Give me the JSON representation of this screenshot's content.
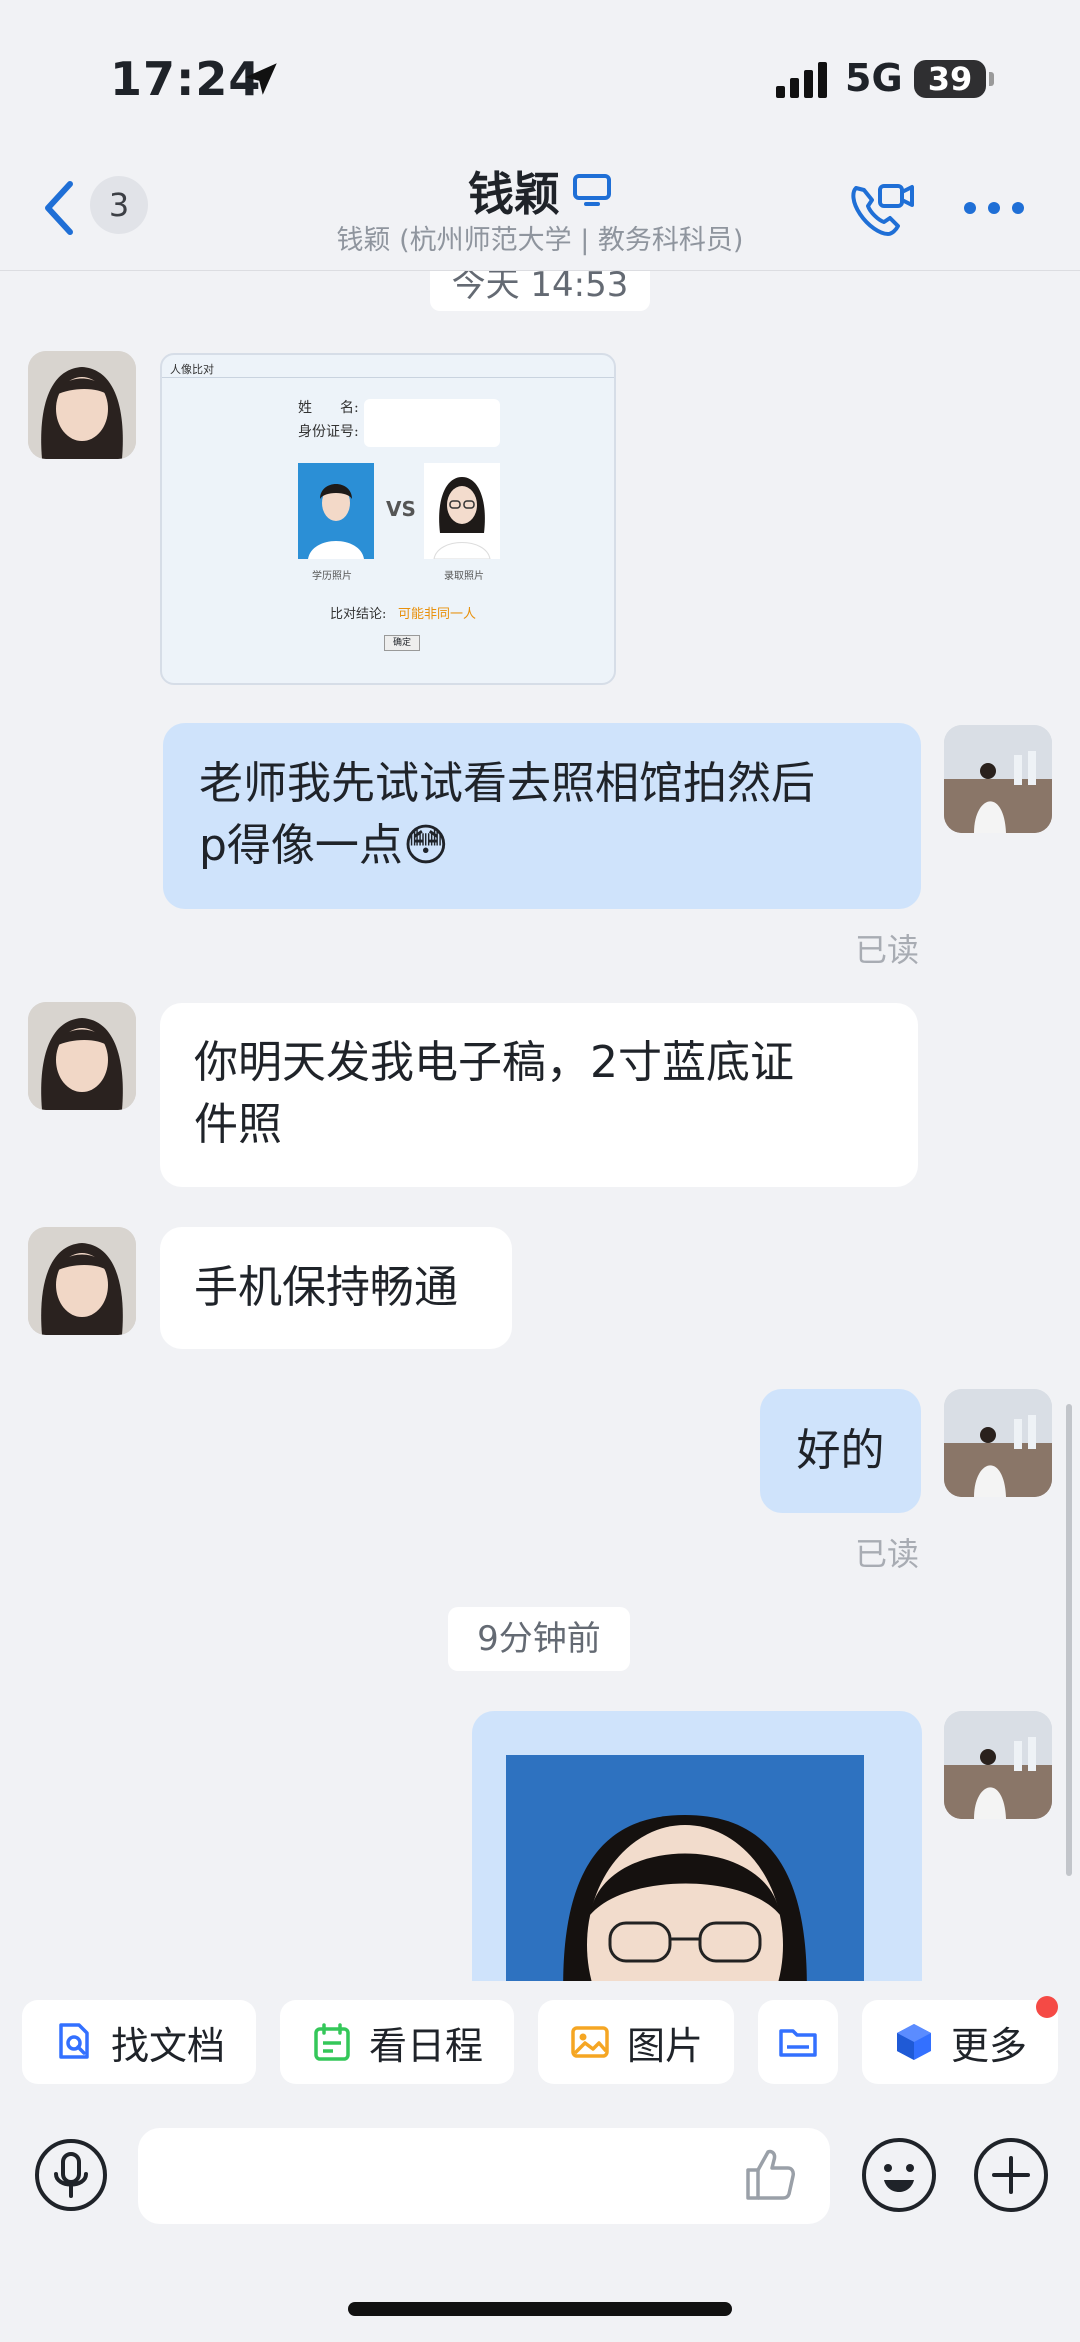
{
  "status_bar": {
    "time": "17:24",
    "network": "5G",
    "battery": "39"
  },
  "header": {
    "back_badge": "3",
    "contact_name": "钱颖",
    "contact_subtitle": "钱颖 (杭州师范大学 | 教务科科员)"
  },
  "chat": {
    "timestamp_1": "今天 14:53",
    "comparison_card": {
      "tab_title": "人像比对",
      "name_label": "姓　　名:",
      "id_label": "身份证号:",
      "vs": "VS",
      "photo_left_label": "学历照片",
      "photo_right_label": "录取照片",
      "conclusion_label": "比对结论:",
      "conclusion_value": "可能非同一人",
      "confirm_button": "确定"
    },
    "msg_out_1_line1": "老师我先试试看去照相馆拍然后",
    "msg_out_1_line2": "p得像一点😳",
    "read_1": "已读",
    "msg_in_1_line1": "你明天发我电子稿，2寸蓝底证",
    "msg_in_1_line2": "件照",
    "msg_in_2": "手机保持畅通",
    "msg_out_2": "好的",
    "read_2": "已读",
    "timestamp_2": "9分钟前"
  },
  "quick_actions": [
    {
      "label": "找文档",
      "icon": "doc-search-icon",
      "color": "#3370ff"
    },
    {
      "label": "看日程",
      "icon": "calendar-icon",
      "color": "#34c759"
    },
    {
      "label": "图片",
      "icon": "image-icon",
      "color": "#f5a623"
    },
    {
      "label": "",
      "icon": "folder-icon",
      "color": "#3370ff"
    },
    {
      "label": "更多",
      "icon": "more-apps-icon",
      "color": "#3370ff"
    }
  ],
  "colors": {
    "accent": "#1f6fd6",
    "bubble_out": "#cfe3fb",
    "background": "#f1f2f5"
  }
}
